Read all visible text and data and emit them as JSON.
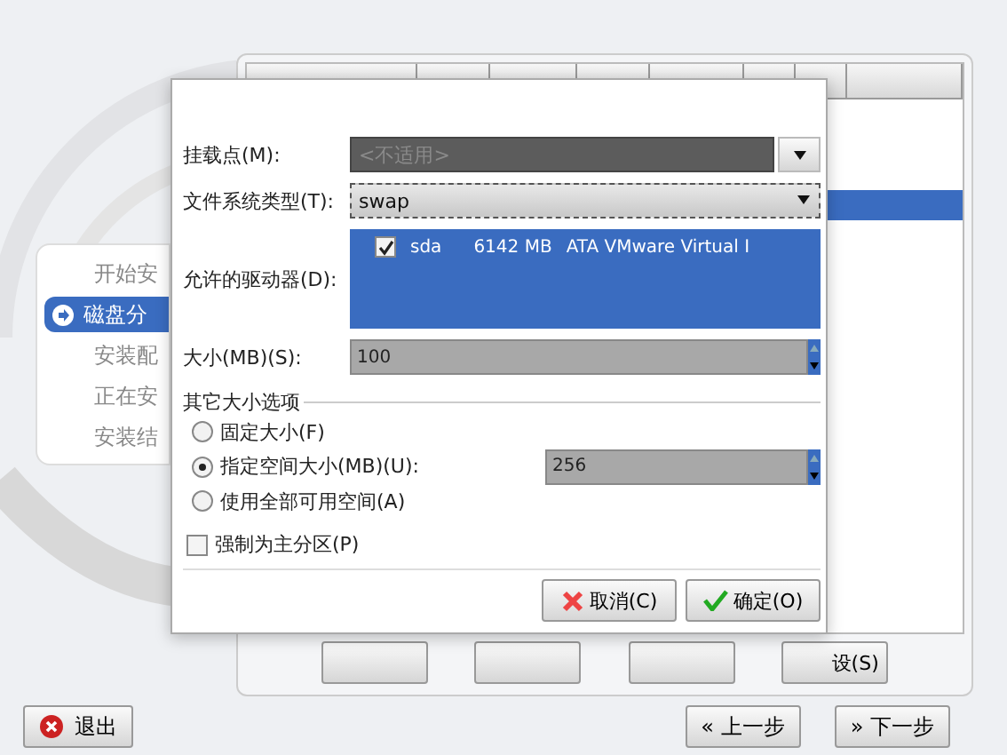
{
  "steps": [
    {
      "label": "开始安",
      "selected": false
    },
    {
      "label": "磁盘分",
      "selected": true
    },
    {
      "label": "安装配",
      "selected": false
    },
    {
      "label": "正在安",
      "selected": false
    },
    {
      "label": "安装结",
      "selected": false
    }
  ],
  "table": {
    "rows": [
      {
        "selected": false
      },
      {
        "selected": false
      },
      {
        "selected": false
      },
      {
        "selected": true
      }
    ]
  },
  "panel_buttons": [
    {
      "kind": "obscured"
    },
    {
      "kind": "obscured"
    },
    {
      "kind": "obscured"
    },
    {
      "kind": "label",
      "label": "设(S)"
    }
  ],
  "nav": {
    "quit": "退出",
    "back": {
      "glyph": "«",
      "label": "上一步"
    },
    "next": {
      "glyph": "»",
      "label": "下一步"
    }
  },
  "dialog": {
    "mount_point": {
      "label": "挂载点(M):",
      "placeholder": "<不适用>",
      "disabled": true
    },
    "fs_type": {
      "label": "文件系统类型(T):",
      "value": "swap"
    },
    "drives": {
      "label": "允许的驱动器(D):",
      "items": [
        {
          "name": "sda",
          "size": "6142 MB",
          "model": "ATA VMware Virtual I",
          "checked": true
        }
      ]
    },
    "size": {
      "label": "大小(MB)(S):",
      "value": "100"
    },
    "size_options": {
      "title": "其它大小选项",
      "options": [
        {
          "label": "固定大小(F)",
          "selected": false
        },
        {
          "label": "指定空间大小(MB)(U):",
          "selected": true,
          "value": "256"
        },
        {
          "label": "使用全部可用空间(A)",
          "selected": false
        }
      ]
    },
    "primary": {
      "label": "强制为主分区(P)",
      "checked": false
    },
    "buttons": [
      {
        "kind": "cancel",
        "label": "取消(C)"
      },
      {
        "kind": "ok",
        "label": "确定(O)"
      }
    ]
  }
}
